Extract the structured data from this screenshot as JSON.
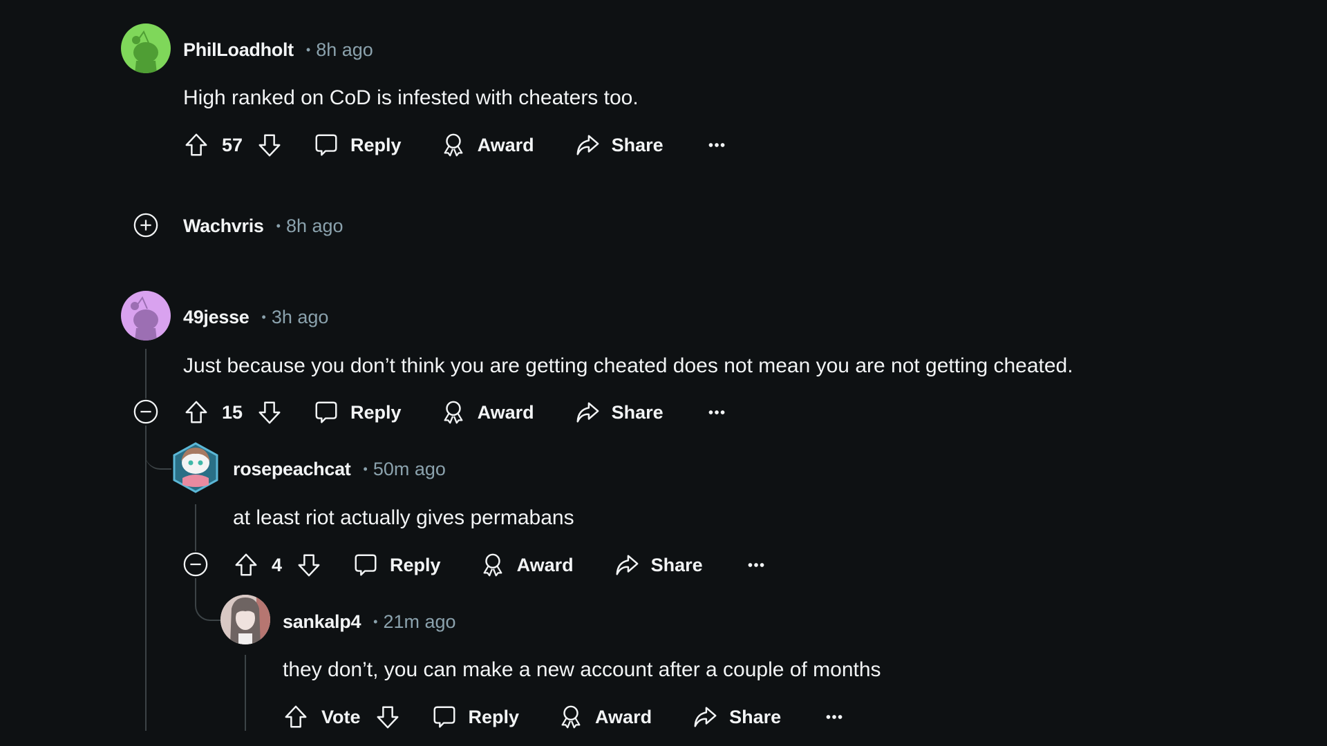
{
  "comments": [
    {
      "username": "PhilLoadholt",
      "time": "8h ago",
      "separator": "•",
      "avatar": {
        "type": "default-snoo",
        "color": "#7fd75a",
        "shade": "#4f9e34"
      },
      "body": "High ranked on CoD is infested with cheaters too.",
      "votes": "57",
      "actions": {
        "reply": "Reply",
        "award": "Award",
        "share": "Share",
        "more": "more-options"
      }
    },
    {
      "username": "Wachvris",
      "time": "8h ago",
      "separator": "•",
      "collapsed": true,
      "toggle_icon": "expand-plus-icon"
    },
    {
      "username": "49jesse",
      "time": "3h ago",
      "separator": "•",
      "avatar": {
        "type": "default-snoo",
        "color": "#d9a2ef",
        "shade": "#9c6fb3"
      },
      "body": "Just because you don’t think you are getting cheated does not mean you are not getting cheated.",
      "votes": "15",
      "toggle_icon": "collapse-minus-icon",
      "actions": {
        "reply": "Reply",
        "award": "Award",
        "share": "Share",
        "more": "more-options"
      }
    },
    {
      "username": "rosepeachcat",
      "time": "50m ago",
      "separator": "•",
      "avatar": {
        "type": "custom-snoo-hexagon",
        "color": "#5bb7d6"
      },
      "body": "at least riot actually gives permabans",
      "votes": "4",
      "toggle_icon": "collapse-minus-icon",
      "actions": {
        "reply": "Reply",
        "award": "Award",
        "share": "Share",
        "more": "more-options"
      }
    },
    {
      "username": "sankalp4",
      "time": "21m ago",
      "separator": "•",
      "avatar": {
        "type": "anime-portrait",
        "color": "#b39a96"
      },
      "body": "they don’t, you can make a new account after a couple of months",
      "votes": "Vote",
      "actions": {
        "reply": "Reply",
        "award": "Award",
        "share": "Share",
        "more": "more-options"
      }
    }
  ],
  "colors": {
    "background": "#0e1113",
    "text": "#f2f4f5",
    "meta": "#8ba2ad",
    "thread_line": "#3c4346"
  }
}
